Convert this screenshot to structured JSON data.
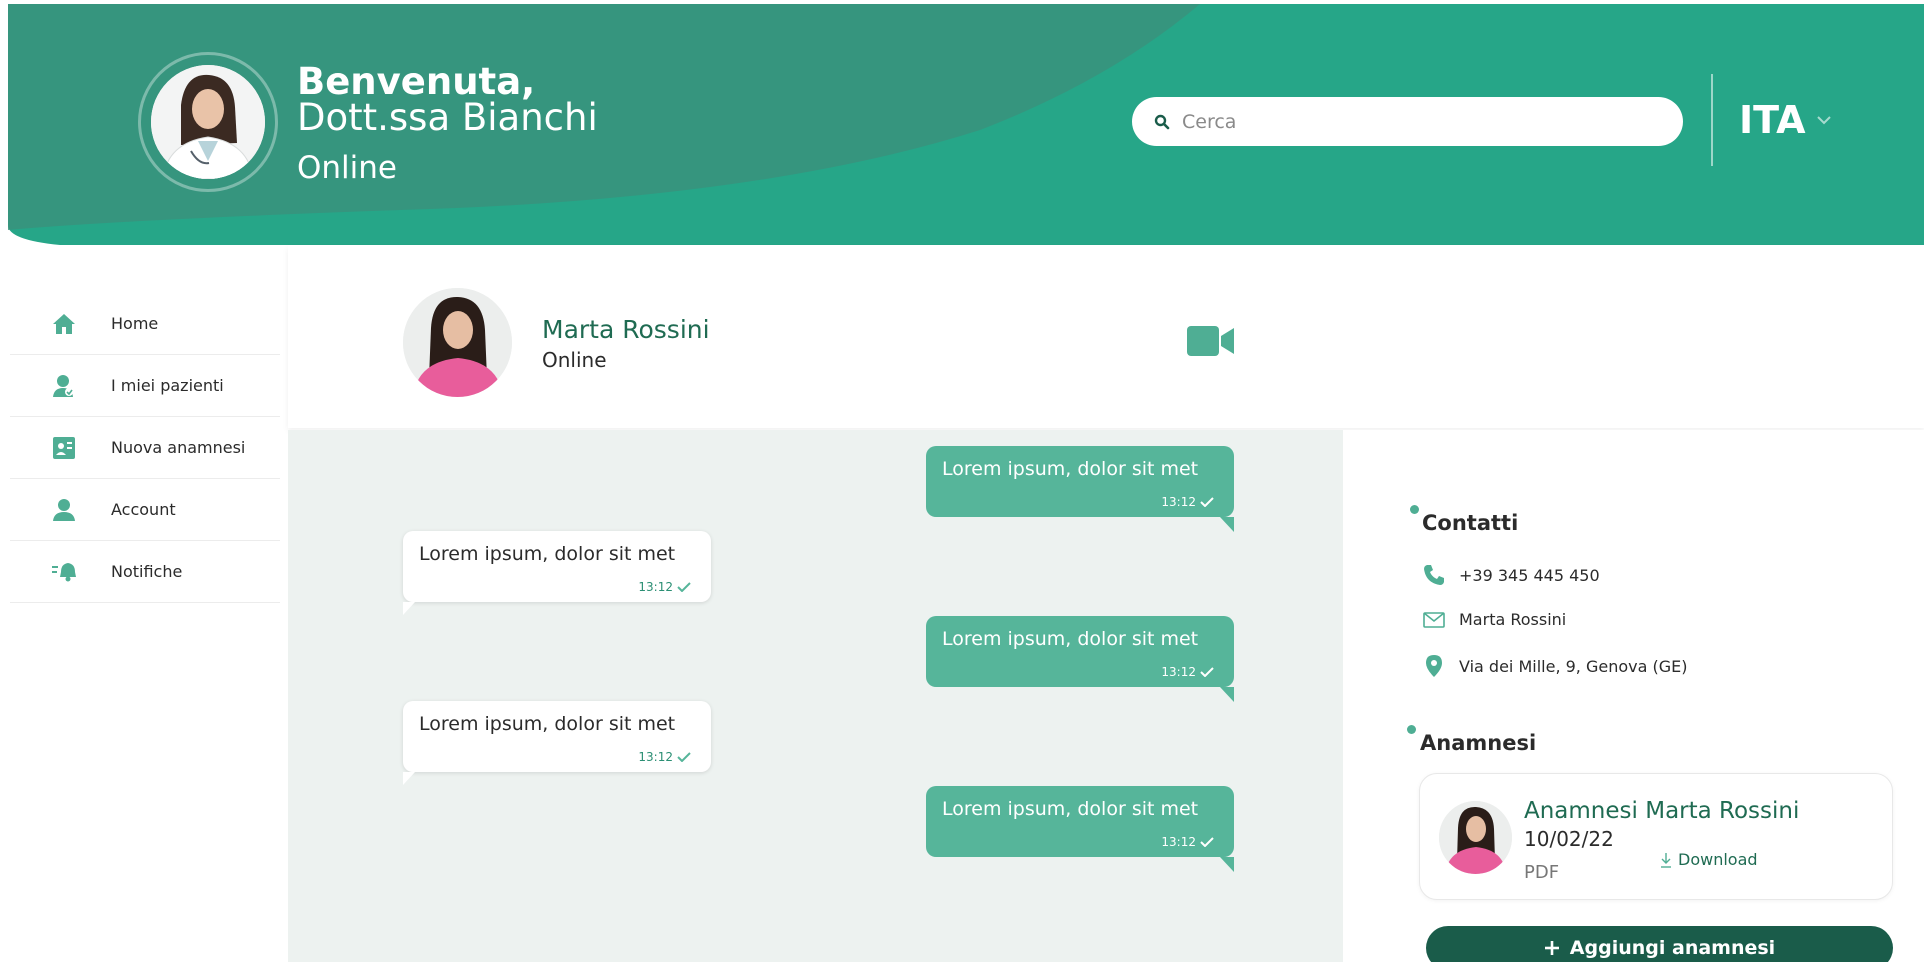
{
  "header": {
    "welcome_line1": "Benvenuta,",
    "welcome_line2": "Dott.ssa Bianchi",
    "status": "Online",
    "search_placeholder": "Cerca",
    "language": "ITA"
  },
  "sidebar": {
    "items": [
      {
        "label": "Home",
        "icon": "home-icon"
      },
      {
        "label": "I miei pazienti",
        "icon": "patients-icon"
      },
      {
        "label": "Nuova anamnesi",
        "icon": "new-anamnesis-icon"
      },
      {
        "label": "Account",
        "icon": "account-icon"
      },
      {
        "label": "Notifiche",
        "icon": "bell-icon"
      }
    ]
  },
  "chat": {
    "patient_name": "Marta Rossini",
    "patient_status": "Online",
    "messages": [
      {
        "direction": "out",
        "text": "Lorem ipsum, dolor sit met",
        "time": "13:12"
      },
      {
        "direction": "in",
        "text": "Lorem ipsum, dolor sit met",
        "time": "13:12"
      },
      {
        "direction": "out",
        "text": "Lorem ipsum, dolor sit met",
        "time": "13:12"
      },
      {
        "direction": "in",
        "text": "Lorem ipsum, dolor sit met",
        "time": "13:12"
      },
      {
        "direction": "out",
        "text": "Lorem ipsum, dolor sit met",
        "time": "13:12"
      }
    ]
  },
  "contacts": {
    "title": "Contatti",
    "phone": "+39 345 445 450",
    "email": "Marta Rossini",
    "address": "Via dei Mille, 9, Genova (GE)"
  },
  "anamnesi": {
    "title": "Anamnesi",
    "card_title": "Anamnesi Marta Rossini",
    "card_date": "10/02/22",
    "card_type": "PDF",
    "download_label": "Download",
    "add_button": "Aggiungi anamnesi"
  },
  "colors": {
    "brand_green": "#26a688",
    "dark_green": "#1a5c4a",
    "bubble_green": "#56b59a",
    "chat_bg": "#edf2f0"
  }
}
